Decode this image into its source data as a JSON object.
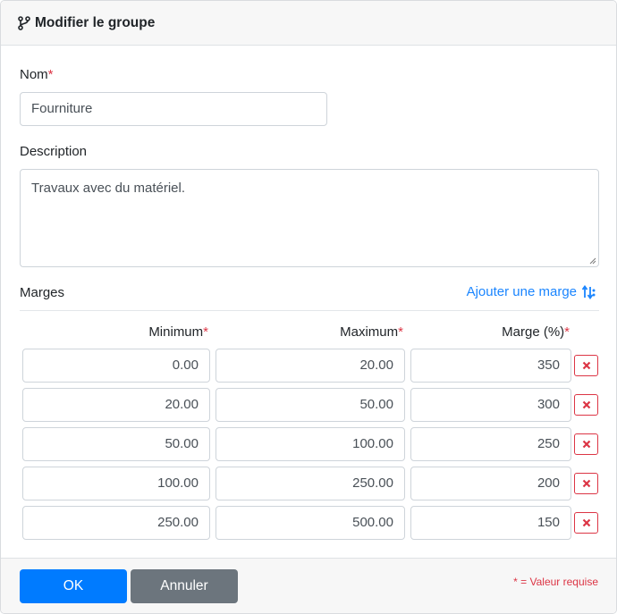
{
  "dialog": {
    "title": "Modifier le groupe",
    "title_icon": "code-branch-icon"
  },
  "form": {
    "nom": {
      "label": "Nom",
      "required_mark": "*",
      "value": "Fourniture"
    },
    "description": {
      "label": "Description",
      "value": "Travaux avec du matériel."
    },
    "marges": {
      "label": "Marges",
      "add_label": "Ajouter une marge",
      "add_icon": "sort-arrows-icon",
      "columns": [
        {
          "label": "Minimum",
          "required_mark": "*"
        },
        {
          "label": "Maximum",
          "required_mark": "*"
        },
        {
          "label": "Marge (%)",
          "required_mark": "*"
        }
      ],
      "rows": [
        {
          "min": "0.00",
          "max": "20.00",
          "marge": "350"
        },
        {
          "min": "20.00",
          "max": "50.00",
          "marge": "300"
        },
        {
          "min": "50.00",
          "max": "100.00",
          "marge": "250"
        },
        {
          "min": "100.00",
          "max": "250.00",
          "marge": "200"
        },
        {
          "min": "250.00",
          "max": "500.00",
          "marge": "150"
        }
      ],
      "delete_icon": "close-icon"
    }
  },
  "footer": {
    "ok_label": "OK",
    "cancel_label": "Annuler",
    "required_note": "* = Valeur requise"
  },
  "colors": {
    "primary": "#007bff",
    "secondary": "#6c757d",
    "danger": "#dc3545",
    "link": "#1a85ff"
  }
}
